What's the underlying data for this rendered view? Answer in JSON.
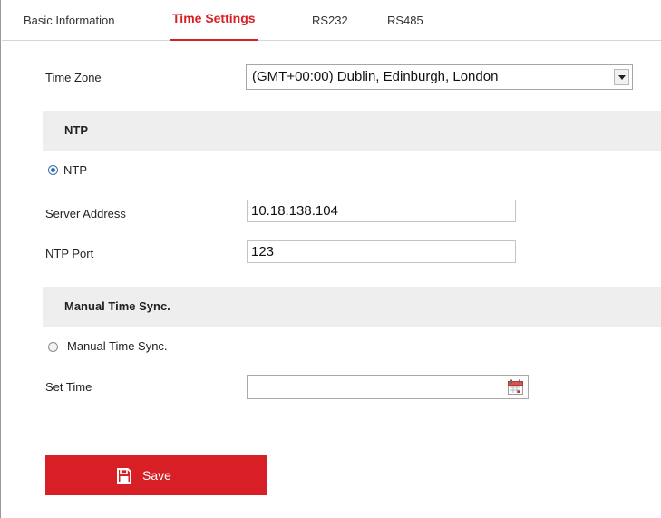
{
  "tabs": [
    {
      "label": "Basic Information",
      "active": false
    },
    {
      "label": "Time Settings",
      "active": true
    },
    {
      "label": "RS232",
      "active": false
    },
    {
      "label": "RS485",
      "active": false
    }
  ],
  "time_zone": {
    "label": "Time Zone",
    "selected": "(GMT+00:00) Dublin, Edinburgh, London"
  },
  "ntp_section": {
    "title": "NTP",
    "radio_label": "NTP",
    "radio_checked": true,
    "server_address_label": "Server Address",
    "server_address_value": "10.18.138.104",
    "ntp_port_label": "NTP Port",
    "ntp_port_value": "123"
  },
  "manual_section": {
    "title": "Manual Time Sync.",
    "radio_label": "Manual Time Sync.",
    "radio_checked": false,
    "set_time_label": "Set Time",
    "set_time_value": ""
  },
  "save_button": {
    "label": "Save",
    "icon": "floppy-disk-icon"
  },
  "colors": {
    "accent": "#d81f26",
    "section_bg": "#eeeeee",
    "radio_selected": "#2a6cbf"
  }
}
